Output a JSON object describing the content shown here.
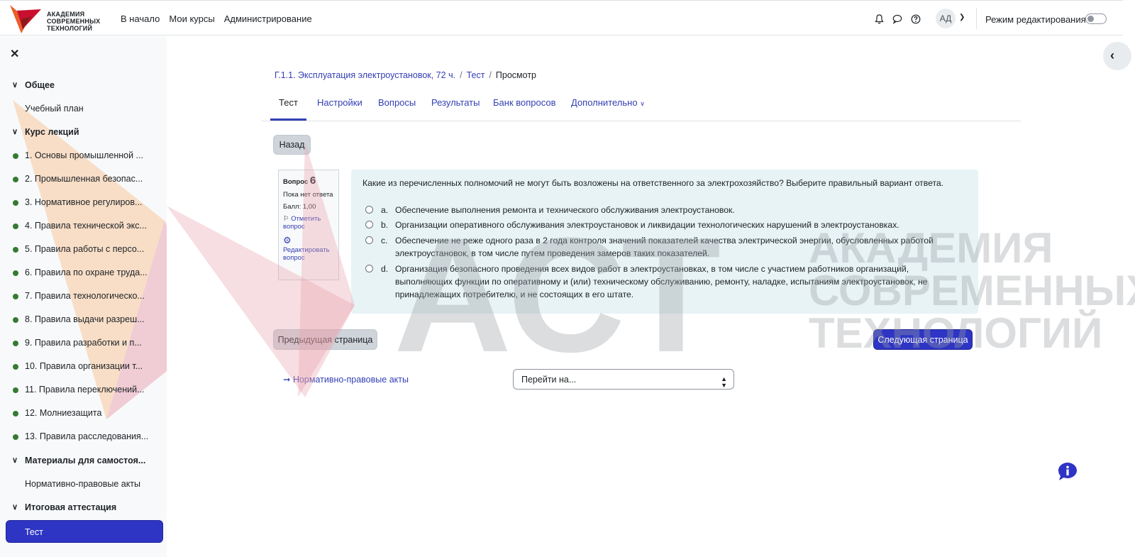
{
  "brand": {
    "logo_line1": "АКАДЕМИЯ",
    "logo_line2": "СОВРЕМЕННЫХ",
    "logo_line3": "ТЕХНОЛОГИЙ"
  },
  "nav": {
    "links": [
      "В начало",
      "Мои курсы",
      "Администрирование"
    ],
    "avatar_initials": "АД",
    "edit_mode_label": "Режим редактирования",
    "edit_mode_on": false
  },
  "sidebar": {
    "sections": [
      {
        "title": "Общее",
        "items": [
          "Учебный план"
        ]
      },
      {
        "title": "Курс лекций",
        "items": [
          "1. Основы промышленной ...",
          "2. Промышленная безопас...",
          "3. Нормативное регулиров...",
          "4. Правила технической экс...",
          "5. Правила работы с персо...",
          "6. Правила по охране труда...",
          "7. Правила технологическо...",
          "8. Правила выдачи разреш...",
          "9. Правила разработки и п...",
          "10. Правила организации т...",
          "11. Правила переключений...",
          "12. Молниезащита",
          "13. Правила расследования..."
        ]
      },
      {
        "title": "Материалы для самостоя...",
        "items": [
          "Нормативно-правовые акты"
        ]
      },
      {
        "title": "Итоговая аттестация",
        "items": [
          "Тест"
        ]
      }
    ]
  },
  "breadcrumb": {
    "course": "Г.1.1. Эксплуатация электроустановок, 72 ч.",
    "quiz": "Тест",
    "current": "Просмотр"
  },
  "tabs": [
    "Тест",
    "Настройки",
    "Вопросы",
    "Результаты",
    "Банк вопросов",
    "Дополнительно"
  ],
  "buttons": {
    "back": "Назад",
    "prev_page": "Предыдущая страница",
    "next_page": "Следующая страница"
  },
  "question_info": {
    "label": "Вопрос",
    "number": "6",
    "status": "Пока нет ответа",
    "score": "Балл: 1,00",
    "flag": "Отметить вопрос",
    "edit": "Редактировать вопрос"
  },
  "question": {
    "text": "Какие из перечисленных полномочий не могут быть возложены на ответственного за электрохозяйство? Выберите правильный вариант ответа.",
    "answers": [
      {
        "letter": "a.",
        "text": "Обеспечение выполнения ремонта и технического обслуживания электроустановок."
      },
      {
        "letter": "b.",
        "text": "Организации оперативного обслуживания электроустановок и ликвидации технологических нарушений в электроустановках."
      },
      {
        "letter": "c.",
        "text": "Обеспечение не реже одного раза в 2 года контроля значений показателей качества электрической энергии, обусловленных работой электроустановок, в том числе путем проведения замеров таких показателей."
      },
      {
        "letter": "d.",
        "text": "Организация безопасного проведения всех видов работ в электроустановках, в том числе с участием работников организаций, выполняющих функции по оперативному и (или) техническому обслуживанию, ремонту, наладке, испытаниям электроустановок, не принадлежащих потребителю, и не состоящих в его штате."
      }
    ]
  },
  "footer_nav": {
    "prev_activity": "➞ Нормативно-правовые акты",
    "jump_placeholder": "Перейти на..."
  },
  "watermark": {
    "big": "АСТ",
    "line1": "АКАДЕМИЯ",
    "line2": "СОВРЕМЕННЫХ",
    "line3": "ТЕХНОЛОГИЙ"
  },
  "colors": {
    "primary": "#2e35c4",
    "link": "#3440b3",
    "question_bg": "#e7f3f5",
    "dot_green": "#357a32"
  }
}
